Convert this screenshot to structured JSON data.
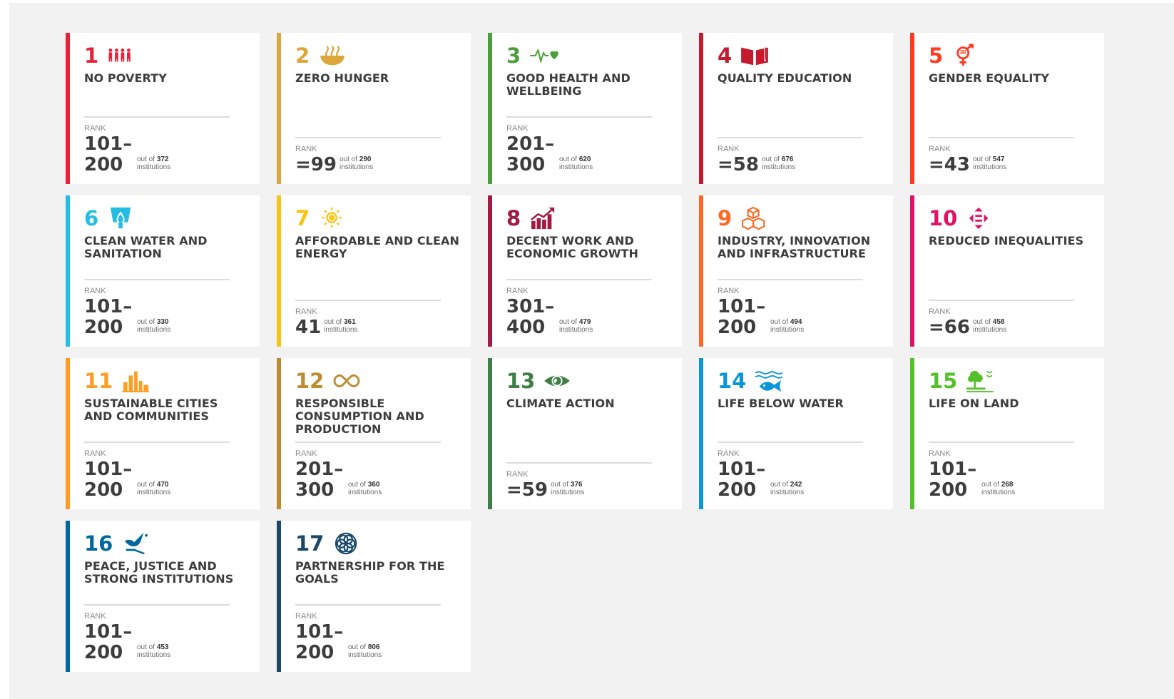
{
  "rank_label": "RANK",
  "out_of_prefix": "out of",
  "institutions_label": "institutions",
  "goals": [
    {
      "num": "1",
      "title": "NO POVERTY",
      "rank": [
        "101–",
        "200"
      ],
      "total": "372",
      "color": "#e5243b",
      "icon": "people-icon"
    },
    {
      "num": "2",
      "title": "ZERO HUNGER",
      "rank": [
        "=99"
      ],
      "total": "290",
      "color": "#dda63a",
      "icon": "bowl-icon"
    },
    {
      "num": "3",
      "title": "GOOD HEALTH AND WELLBEING",
      "rank": [
        "201–",
        "300"
      ],
      "total": "620",
      "color": "#4c9f38",
      "icon": "heartbeat-icon"
    },
    {
      "num": "4",
      "title": "QUALITY EDUCATION",
      "rank": [
        "=58"
      ],
      "total": "676",
      "color": "#c5192d",
      "icon": "book-icon"
    },
    {
      "num": "5",
      "title": "GENDER EQUALITY",
      "rank": [
        "=43"
      ],
      "total": "547",
      "color": "#ff3a21",
      "icon": "gender-icon"
    },
    {
      "num": "6",
      "title": "CLEAN WATER AND SANITATION",
      "rank": [
        "101–",
        "200"
      ],
      "total": "330",
      "color": "#26bde2",
      "icon": "water-drop-icon"
    },
    {
      "num": "7",
      "title": "AFFORDABLE AND CLEAN ENERGY",
      "rank": [
        "41"
      ],
      "total": "361",
      "color": "#fcc30b",
      "icon": "sun-icon"
    },
    {
      "num": "8",
      "title": "DECENT WORK AND ECONOMIC GROWTH",
      "rank": [
        "301–",
        "400"
      ],
      "total": "479",
      "color": "#a21942",
      "icon": "growth-chart-icon"
    },
    {
      "num": "9",
      "title": "INDUSTRY, INNOVATION AND INFRASTRUCTURE",
      "rank": [
        "101–",
        "200"
      ],
      "total": "494",
      "color": "#fd6925",
      "icon": "cubes-icon"
    },
    {
      "num": "10",
      "title": "REDUCED INEQUALITIES",
      "rank": [
        "=66"
      ],
      "total": "458",
      "color": "#dd1367",
      "icon": "equality-arrows-icon"
    },
    {
      "num": "11",
      "title": "SUSTAINABLE CITIES AND COMMUNITIES",
      "rank": [
        "101–",
        "200"
      ],
      "total": "470",
      "color": "#fd9d24",
      "icon": "city-icon"
    },
    {
      "num": "12",
      "title": "RESPONSIBLE CONSUMPTION AND PRODUCTION",
      "rank": [
        "201–",
        "300"
      ],
      "total": "360",
      "color": "#bf8b2e",
      "icon": "infinity-icon"
    },
    {
      "num": "13",
      "title": "CLIMATE ACTION",
      "rank": [
        "=59"
      ],
      "total": "376",
      "color": "#3f7e44",
      "icon": "eye-globe-icon"
    },
    {
      "num": "14",
      "title": "LIFE BELOW WATER",
      "rank": [
        "101–",
        "200"
      ],
      "total": "242",
      "color": "#0a97d9",
      "icon": "fish-icon"
    },
    {
      "num": "15",
      "title": "LIFE ON LAND",
      "rank": [
        "101–",
        "200"
      ],
      "total": "268",
      "color": "#56c02b",
      "icon": "tree-icon"
    },
    {
      "num": "16",
      "title": "PEACE, JUSTICE AND STRONG INSTITUTIONS",
      "rank": [
        "101–",
        "200"
      ],
      "total": "453",
      "color": "#00689d",
      "icon": "dove-icon"
    },
    {
      "num": "17",
      "title": "PARTNERSHIP FOR THE GOALS",
      "rank": [
        "101–",
        "200"
      ],
      "total": "806",
      "color": "#19486a",
      "icon": "flower-icon"
    }
  ]
}
